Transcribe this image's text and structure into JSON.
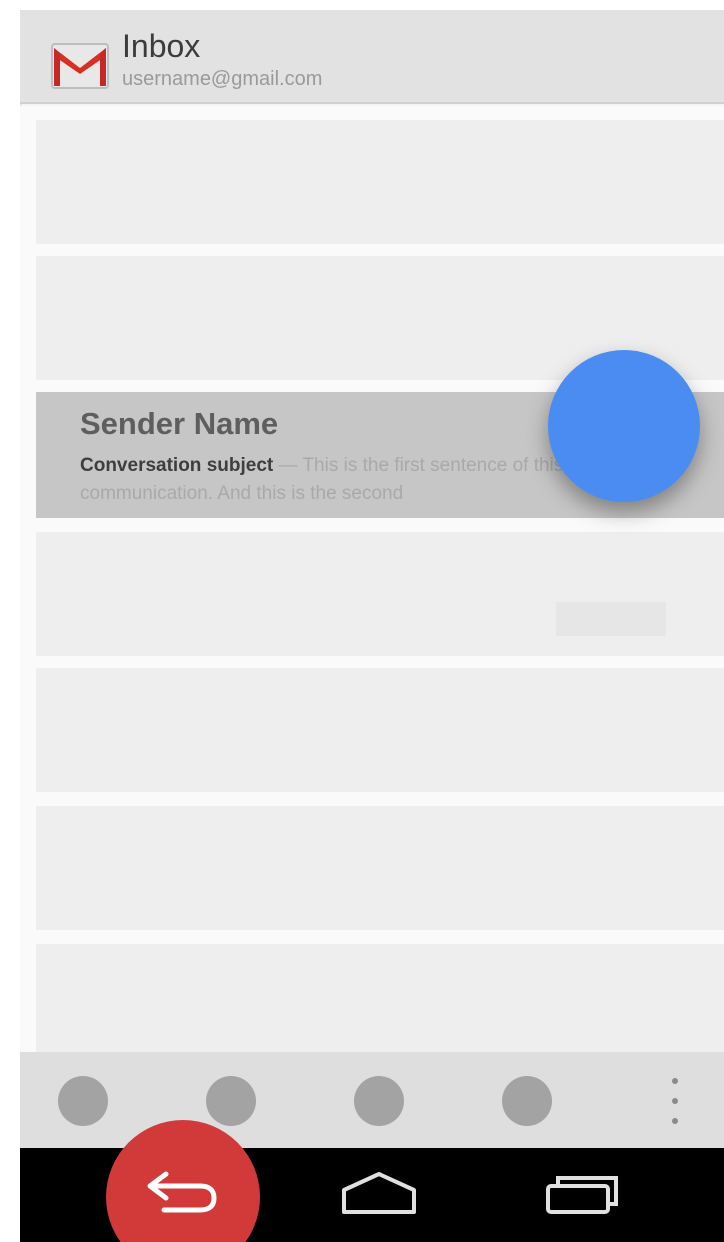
{
  "header": {
    "title": "Inbox",
    "account": "username@gmail.com",
    "logo_icon": "gmail-icon"
  },
  "selected_message": {
    "sender": "Sender Name",
    "subject": "Conversation subject",
    "separator": " — ",
    "snippet": "This is the first sentence of this unread communication. And this is the second"
  },
  "fab": {
    "color": "#4a8cf2"
  },
  "action_bar": {
    "items": [
      "action-dot",
      "action-dot",
      "action-dot",
      "action-dot"
    ],
    "overflow_icon": "overflow-menu-icon"
  },
  "nav_bar": {
    "back_icon": "back-icon",
    "home_icon": "home-icon",
    "recents_icon": "recents-icon",
    "back_highlight_color": "#d23a3a"
  }
}
